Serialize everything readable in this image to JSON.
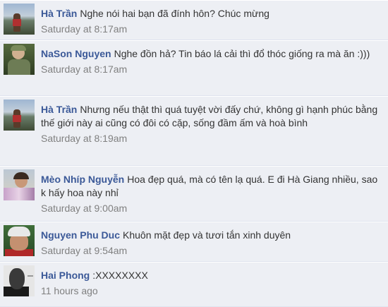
{
  "comments": [
    {
      "author": "Hà Trần",
      "text": "Nghe nói hai bạn đã đính hôn? Chúc mừng",
      "time": "Saturday at 8:17am",
      "avatar_icon": "profile-photo-ha-tran"
    },
    {
      "author": "NaSon Nguyen",
      "text": "Nghe đồn hả? Tin báo lá cải thì đổ thóc giống ra mà ăn :)))",
      "time": "Saturday at 8:17am",
      "avatar_icon": "profile-photo-nason-nguyen"
    },
    {
      "author": "Hà Trần",
      "text": "Nhưng nếu thật thì quá tuyệt vời đấy chứ, không gì hạnh phúc bằng thế giới này ai cũng có đôi có cặp, sống đầm ấm và hoà bình",
      "time": "Saturday at 8:19am",
      "avatar_icon": "profile-photo-ha-tran"
    },
    {
      "author": "Mèo Nhíp Nguyễn",
      "text": "Hoa đẹp quá, mà có tên lạ quá. E đi Hà Giang nhiều, sao k hấy hoa này nhỉ",
      "time": "Saturday at 9:00am",
      "avatar_icon": "profile-photo-meo-nhip-nguyen"
    },
    {
      "author": "Nguyen Phu Duc",
      "text": "Khuôn mặt đẹp và tươi tắn xinh duyên",
      "time": "Saturday at 9:54am",
      "avatar_icon": "profile-photo-nguyen-phu-duc"
    },
    {
      "author": "Hai Phong",
      "text": ":XXXXXXXX",
      "time": "11 hours ago",
      "avatar_icon": "profile-photo-hai-phong"
    }
  ],
  "colors": {
    "background": "#edeff4",
    "author_link": "#3b5998",
    "text": "#333333",
    "timestamp": "#808080",
    "divider": "#dfe3ee"
  }
}
